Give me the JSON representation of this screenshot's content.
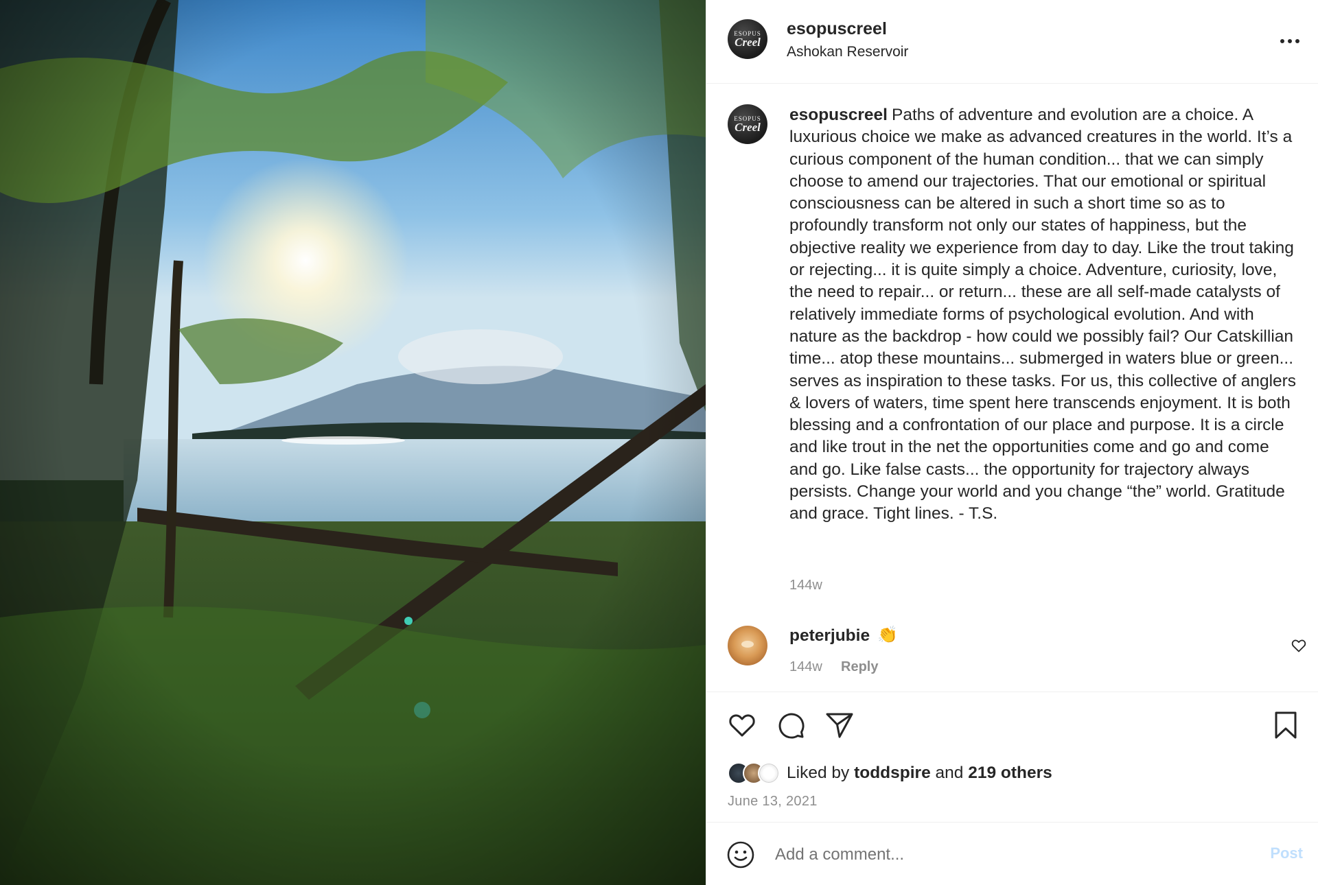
{
  "post": {
    "username": "esopuscreel",
    "location": "Ashokan Reservoir",
    "avatar_text_top": "ESOPUS",
    "avatar_text_main": "Creel",
    "caption": "Paths of adventure and evolution are a choice. A luxurious choice we make as advanced creatures in the world. It’s a curious component of the human condition... that we can simply choose to amend our trajectories. That our emotional or spiritual consciousness can be altered in such a short time so as to profoundly transform not only our states of happiness, but the objective reality we experience from day to day. Like the trout taking or rejecting... it is quite simply a choice. Adventure, curiosity, love, the need to repair... or return... these are all self-made catalysts of relatively immediate forms of psychological evolution. And with nature as the backdrop - how could we possibly fail? Our Catskillian time... atop these mountains... submerged in waters blue or green... serves as inspiration to these tasks. For us, this collective of anglers & lovers of waters, time spent here transcends enjoyment. It is both blessing and a confrontation of our place and purpose. It is a circle and like trout in the net the opportunities come and go and come and go. Like false casts... the opportunity for trajectory always persists. Change your world and you change “the” world. Gratitude and grace. Tight lines. - T.S.",
    "caption_time": "144w"
  },
  "comment": {
    "username": "peterjubie",
    "emoji": "👏",
    "time": "144w",
    "reply_label": "Reply"
  },
  "likes": {
    "prefix": "Liked by",
    "liker": "toddspire",
    "joiner": "and",
    "others": "219 others",
    "date": "June 13, 2021"
  },
  "comment_bar": {
    "placeholder": "Add a comment...",
    "post_label": "Post"
  },
  "icons": {
    "more": "more-horizontal-icon",
    "like": "heart-icon",
    "comment": "comment-icon",
    "share": "send-icon",
    "save": "bookmark-icon",
    "emoji": "smiley-icon",
    "comment_like": "heart-icon"
  },
  "colors": {
    "text": "#262626",
    "secondary": "#8e8e8e",
    "post_disabled": "#c0dffd",
    "divider": "#efefef"
  }
}
